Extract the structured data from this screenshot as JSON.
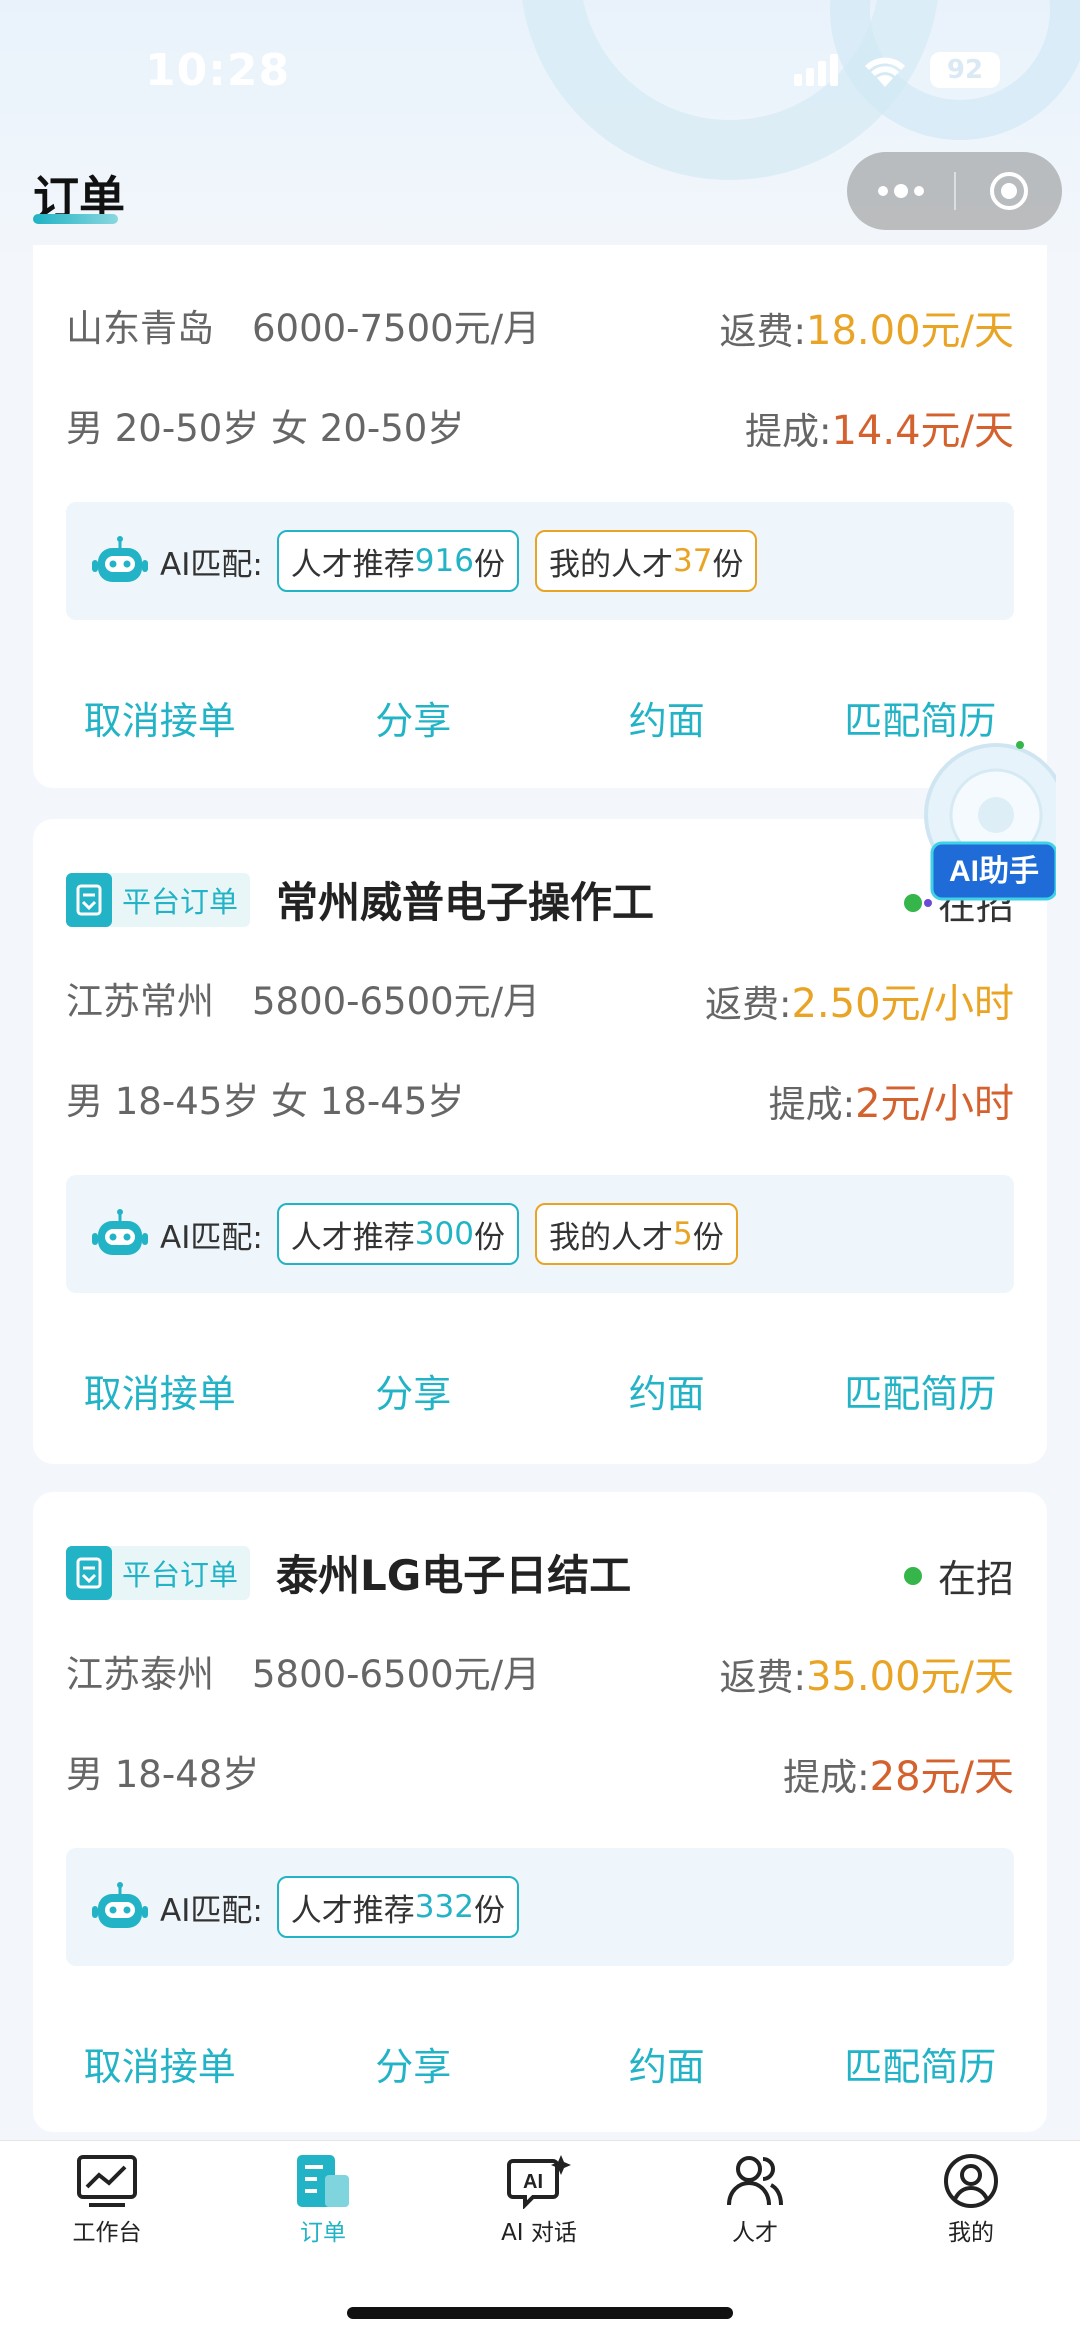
{
  "status_bar": {
    "time": "10:28",
    "battery": "92"
  },
  "header": {
    "title": "订单"
  },
  "orders": [
    {
      "tag": "",
      "title": "",
      "status": "",
      "location": "山东青岛",
      "salary": "6000-7500元/月",
      "fee_label": "返费:",
      "fee_value": "18.00元/天",
      "requirements": "男 20-50岁 女 20-50岁",
      "commission_label": "提成:",
      "commission_value": "14.4元/天",
      "ai_label": "AI匹配:",
      "talent_prefix": "人才推荐",
      "talent_count": "916",
      "talent_suffix": "份",
      "mine_prefix": "我的人才",
      "mine_count": "37",
      "mine_suffix": "份"
    },
    {
      "tag": "平台订单",
      "title": "常州威普电子操作工",
      "status": "在招",
      "location": "江苏常州",
      "salary": "5800-6500元/月",
      "fee_label": "返费:",
      "fee_value": "2.50元/小时",
      "requirements": "男 18-45岁 女 18-45岁",
      "commission_label": "提成:",
      "commission_value": "2元/小时",
      "ai_label": "AI匹配:",
      "talent_prefix": "人才推荐",
      "talent_count": "300",
      "talent_suffix": "份",
      "mine_prefix": "我的人才",
      "mine_count": "5",
      "mine_suffix": "份"
    },
    {
      "tag": "平台订单",
      "title": "泰州LG电子日结工",
      "status": "在招",
      "location": "江苏泰州",
      "salary": "5800-6500元/月",
      "fee_label": "返费:",
      "fee_value": "35.00元/天",
      "requirements": "男 18-48岁",
      "commission_label": "提成:",
      "commission_value": "28元/天",
      "ai_label": "AI匹配:",
      "talent_prefix": "人才推荐",
      "talent_count": "332",
      "talent_suffix": "份"
    }
  ],
  "actions": {
    "cancel": "取消接单",
    "share": "分享",
    "interview": "约面",
    "match": "匹配简历"
  },
  "ai_assistant": {
    "label": "AI助手"
  },
  "tabbar": {
    "items": [
      {
        "label": "工作台",
        "icon": "chart-icon"
      },
      {
        "label": "订单",
        "icon": "order-icon"
      },
      {
        "label": "AI 对话",
        "icon": "ai-chat-icon"
      },
      {
        "label": "人才",
        "icon": "people-icon"
      },
      {
        "label": "我的",
        "icon": "profile-icon"
      }
    ]
  },
  "colors": {
    "accent": "#23b3c6",
    "fee": "#e9a425",
    "commission": "#d4622f",
    "status_green": "#35b54a"
  }
}
